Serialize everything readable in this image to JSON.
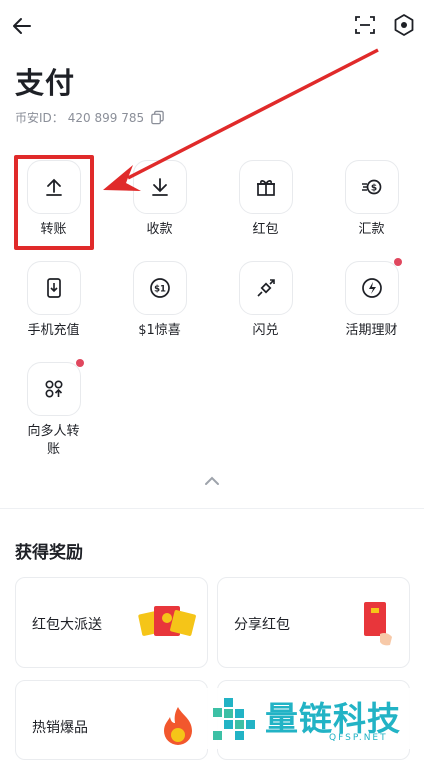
{
  "header": {
    "title": "支付",
    "uid_label": "币安ID：",
    "uid_value": "420 899 785"
  },
  "actions": [
    {
      "label": "转账",
      "icon": "upload-arrow-icon"
    },
    {
      "label": "收款",
      "icon": "download-arrow-icon"
    },
    {
      "label": "红包",
      "icon": "gift-icon"
    },
    {
      "label": "汇款",
      "icon": "remittance-icon"
    },
    {
      "label": "手机充值",
      "icon": "phone-topup-icon"
    },
    {
      "label": "$1惊喜",
      "icon": "dollar-surprise-icon"
    },
    {
      "label": "闪兑",
      "icon": "swap-icon"
    },
    {
      "label": "活期理财",
      "icon": "earn-icon",
      "badge": true
    },
    {
      "label": "向多人转账",
      "icon": "batch-transfer-icon",
      "badge": true
    }
  ],
  "rewards": {
    "title": "获得奖励",
    "cards": [
      {
        "label": "红包大派送"
      },
      {
        "label": "分享红包"
      },
      {
        "label": "热销爆品"
      }
    ]
  },
  "watermark": {
    "text": "量链科技",
    "sub": "QFSP.NET"
  },
  "colors": {
    "highlight": "#e02a2a",
    "badge": "#e0475e",
    "watermark": "#22b3c5"
  }
}
